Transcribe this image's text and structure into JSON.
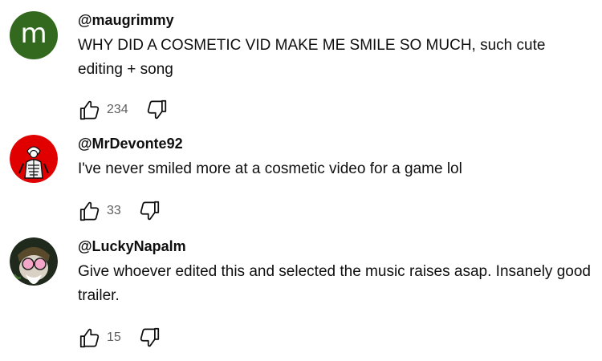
{
  "comments": [
    {
      "avatar_letter": "m",
      "avatar_color": "#33691e",
      "handle": "@maugrimmy",
      "text": "WHY DID A COSMETIC VID MAKE ME SMILE SO MUCH, such cute editing + song",
      "likes": "234"
    },
    {
      "avatar_color": "#e00000",
      "handle": "@MrDevonte92",
      "text": "I've never smiled more at a cosmetic video for a game lol",
      "likes": "33"
    },
    {
      "avatar_color": "#1f2a1c",
      "handle": "@LuckyNapalm",
      "text": "Give whoever edited this and selected the music raises asap. Insanely good trailer.",
      "likes": "15"
    }
  ],
  "icons": {
    "like": "thumbs-up-icon",
    "dislike": "thumbs-down-icon"
  }
}
